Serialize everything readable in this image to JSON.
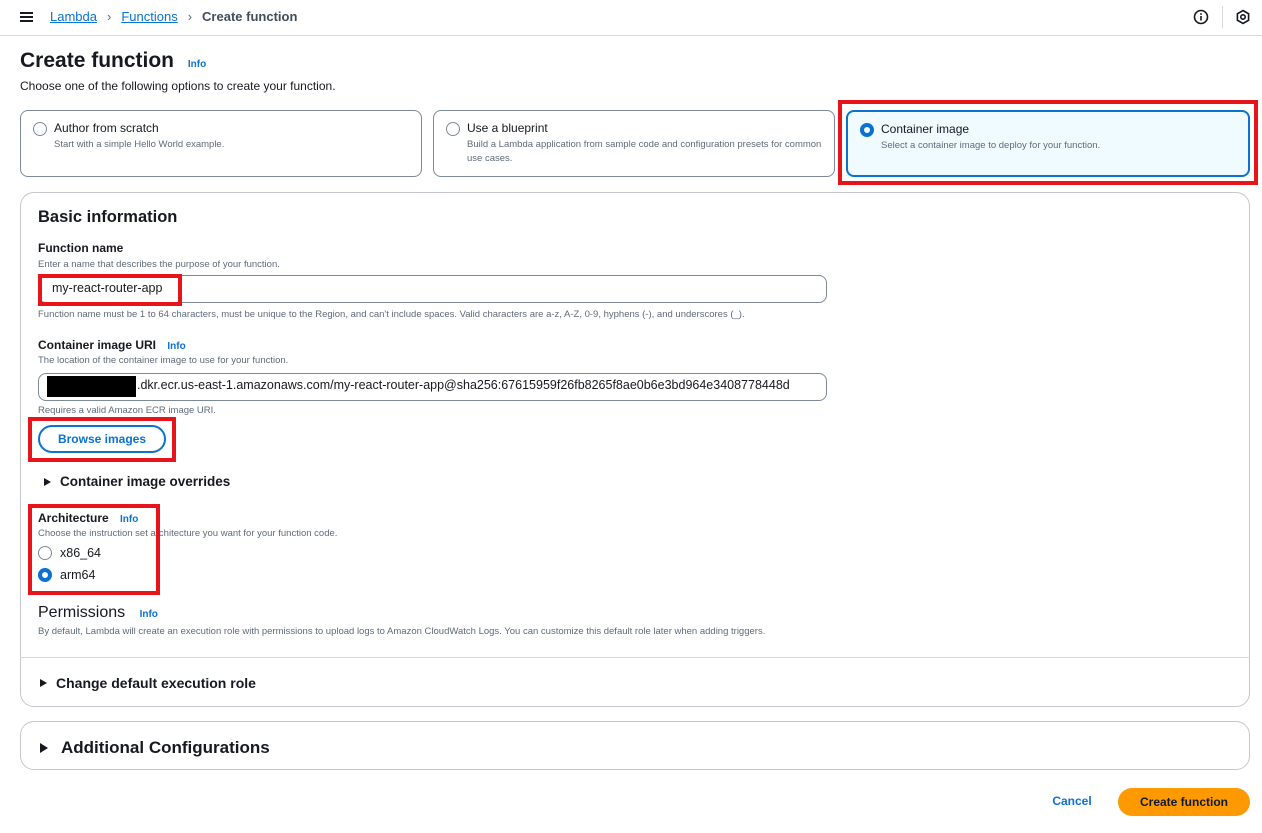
{
  "breadcrumbs": {
    "lambda": "Lambda",
    "functions": "Functions",
    "current": "Create function"
  },
  "icons": {
    "menu": "hamburger-menu-icon",
    "info": "info-circle-icon",
    "settings": "hexagon-gear-icon"
  },
  "page": {
    "title": "Create function",
    "info_link": "Info",
    "subtitle": "Choose one of the following options to create your function."
  },
  "creation_options": [
    {
      "title": "Author from scratch",
      "description": "Start with a simple Hello World example.",
      "selected": false
    },
    {
      "title": "Use a blueprint",
      "description": "Build a Lambda application from sample code and configuration presets for common use cases.",
      "selected": false
    },
    {
      "title": "Container image",
      "description": "Select a container image to deploy for your function.",
      "selected": true
    }
  ],
  "basic_info": {
    "heading": "Basic information",
    "function_name": {
      "label": "Function name",
      "description": "Enter a name that describes the purpose of your function.",
      "value": "my-react-router-app",
      "constraint": "Function name must be 1 to 64 characters, must be unique to the Region, and can't include spaces. Valid characters are a-z, A-Z, 0-9, hyphens (-), and underscores (_)."
    },
    "image_uri": {
      "label": "Container image URI",
      "info_link": "Info",
      "description": "The location of the container image to use for your function.",
      "value_visible": ".dkr.ecr.us-east-1.amazonaws.com/my-react-router-app@sha256:67615959f26fb8265f8ae0b6e3bd964e3408778448d",
      "constraint": "Requires a valid Amazon ECR image URI.",
      "browse_label": "Browse images"
    },
    "overrides_label": "Container image overrides",
    "architecture": {
      "label": "Architecture",
      "info_link": "Info",
      "description": "Choose the instruction set architecture you want for your function code.",
      "options": [
        {
          "label": "x86_64",
          "selected": false
        },
        {
          "label": "arm64",
          "selected": true
        }
      ]
    },
    "permissions": {
      "heading": "Permissions",
      "info_link": "Info",
      "description": "By default, Lambda will create an execution role with permissions to upload logs to Amazon CloudWatch Logs. You can customize this default role later when adding triggers."
    },
    "change_role_label": "Change default execution role"
  },
  "additional_config_label": "Additional Configurations",
  "footer": {
    "cancel": "Cancel",
    "create": "Create function"
  },
  "colors": {
    "primary": "#0972d3",
    "cta": "#ff9900",
    "highlight": "#e8141c",
    "selected_tile_bg": "#f0fbff"
  }
}
